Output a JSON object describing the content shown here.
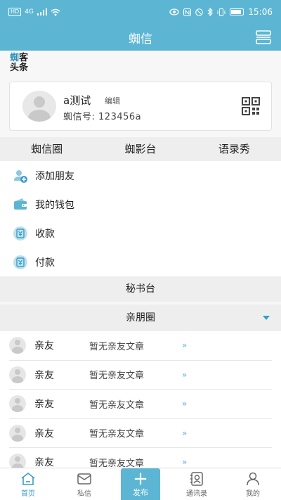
{
  "status_bar": {
    "network": "HD",
    "signal": "4G",
    "time": "15:06"
  },
  "header": {
    "title": "蜘信"
  },
  "logo": {
    "line1_a": "蜘",
    "line1_b": "客",
    "line2": "头条"
  },
  "profile": {
    "name": "a测试",
    "edit_label": "编辑",
    "id_label": "蜘信号:",
    "id_value": "123456a"
  },
  "tabs": [
    {
      "label": "蜘信圈"
    },
    {
      "label": "蜘影台"
    },
    {
      "label": "语录秀"
    }
  ],
  "menu": [
    {
      "label": "添加朋友",
      "icon": "add-friend-icon"
    },
    {
      "label": "我的钱包",
      "icon": "wallet-icon"
    },
    {
      "label": "收款",
      "icon": "receive-money-icon"
    },
    {
      "label": "付款",
      "icon": "pay-icon"
    }
  ],
  "secretary": {
    "label": "秘书台"
  },
  "friends_section": {
    "label": "亲朋圈"
  },
  "friends": [
    {
      "name": "亲友",
      "note": "暂无亲友文章",
      "arrow": "»"
    },
    {
      "name": "亲友",
      "note": "暂无亲友文章",
      "arrow": "»"
    },
    {
      "name": "亲友",
      "note": "暂无亲友文章",
      "arrow": "»"
    },
    {
      "name": "亲友",
      "note": "暂无亲友文章",
      "arrow": "»"
    },
    {
      "name": "亲友",
      "note": "暂无亲友文章",
      "arrow": "»"
    }
  ],
  "bottom_nav": {
    "home": "首页",
    "messages": "私信",
    "publish": "发布",
    "contacts": "通讯录",
    "me": "我的"
  },
  "colors": {
    "brand": "#5cb6d3",
    "accent": "#3a9dc9"
  }
}
